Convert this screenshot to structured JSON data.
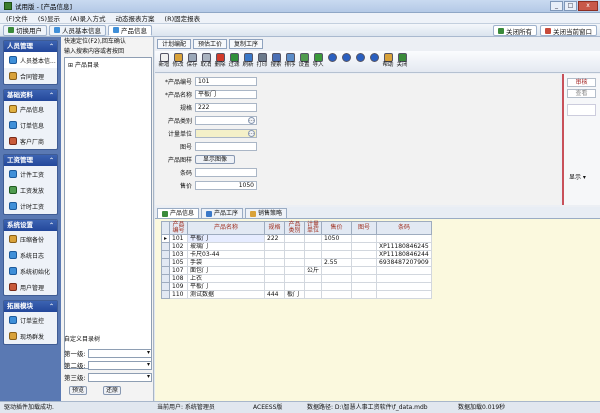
{
  "window": {
    "title": "试用版 - [产品信息]",
    "buttons": [
      "_",
      "□",
      "x"
    ]
  },
  "menu": [
    "(F)文件",
    "(S)显示",
    "(A)录入方式",
    "动态报表方案",
    "(R)固定报表"
  ],
  "navbar": {
    "tabs": [
      {
        "label": "切换用户",
        "active": false
      },
      {
        "label": "人员基本信息",
        "active": false
      },
      {
        "label": "产品信息",
        "active": true
      }
    ],
    "close_all": "关闭所有",
    "close_current": "关闭当前窗口"
  },
  "sidebar": {
    "groups": [
      {
        "title": "人员管理",
        "items": [
          {
            "label": "人员基本信...",
            "selected": true
          },
          {
            "label": "合同管理",
            "selected": false
          }
        ]
      },
      {
        "title": "基础资料",
        "items": [
          {
            "label": "产品信息",
            "selected": false
          },
          {
            "label": "订单信息",
            "selected": false
          },
          {
            "label": "客户厂商",
            "selected": false
          }
        ]
      },
      {
        "title": "工资管理",
        "items": [
          {
            "label": "计件工资",
            "selected": false
          },
          {
            "label": "工资发放",
            "selected": false
          },
          {
            "label": "计时工资",
            "selected": false
          }
        ]
      },
      {
        "title": "系统设置",
        "items": [
          {
            "label": "压缩备份",
            "selected": false
          },
          {
            "label": "系统日志",
            "selected": false
          },
          {
            "label": "系统初始化",
            "selected": false
          },
          {
            "label": "用户管理",
            "selected": false
          }
        ]
      },
      {
        "title": "拓展模块",
        "items": [
          {
            "label": "订单监控",
            "selected": false
          },
          {
            "label": "现场群发",
            "selected": false
          }
        ]
      }
    ]
  },
  "treepane": {
    "hint1": "快速定位(F2),回车确认",
    "hint2": "输入搜索内容或者按回",
    "root": "产品目录",
    "custom_title": "自定义目录树",
    "levels": [
      "第一级:",
      "第二级:",
      "第三级:"
    ],
    "btn_apply": "预览",
    "btn_restore": "还原"
  },
  "subtabs": [
    "计划编配",
    "预估工价",
    "复制工序"
  ],
  "toolbar": [
    {
      "label": "新增",
      "icon": "new-doc-icon",
      "color": "#f0f0f0"
    },
    {
      "label": "修改",
      "icon": "edit-icon",
      "color": "#d9a23a"
    },
    {
      "label": "保存",
      "icon": "save-icon",
      "color": "#9aa7b8"
    },
    {
      "label": "取消",
      "icon": "cancel-icon",
      "color": "#aab3c0"
    },
    {
      "label": "删除",
      "icon": "delete-icon",
      "color": "#d23a2a"
    },
    {
      "label": "过滤",
      "icon": "filter-icon",
      "color": "#2f8f3a"
    },
    {
      "label": "刷新",
      "icon": "refresh-icon",
      "color": "#3a78c8"
    },
    {
      "label": "打印",
      "icon": "print-icon",
      "color": "#6c7a8c"
    },
    {
      "label": "搜索",
      "icon": "search-icon",
      "color": "#4a6fb5"
    },
    {
      "label": "排序",
      "icon": "sort-icon",
      "color": "#5a8cc8"
    },
    {
      "label": "设置",
      "icon": "settings-icon",
      "color": "#4f9b4f"
    },
    {
      "label": "导入",
      "icon": "import-icon",
      "color": "#3b9a3b"
    },
    {
      "label": "",
      "icon": "first-icon",
      "color": "#2a5fc0"
    },
    {
      "label": "",
      "icon": "prev-icon",
      "color": "#2a5fc0"
    },
    {
      "label": "",
      "icon": "next-icon",
      "color": "#2a5fc0"
    },
    {
      "label": "",
      "icon": "last-icon",
      "color": "#2a5fc0"
    },
    {
      "label": "帮助",
      "icon": "help-icon",
      "color": "#d9a23a"
    },
    {
      "label": "关闭",
      "icon": "close-icon",
      "color": "#3a8a3a"
    }
  ],
  "form": {
    "code_label": "*产品编号",
    "code_value": "101",
    "name_label": "*产品名称",
    "name_value": "平板门",
    "spec_label": "规格",
    "spec_value": "222",
    "category_label": "产品类别",
    "category_value": "",
    "unit_label": "计量单位",
    "unit_value": "",
    "drawing_label": "图号",
    "drawing_value": "",
    "image_label": "产品图样",
    "image_button": "显示图像",
    "barcode_label": "条码",
    "barcode_value": "",
    "price_label": "售价",
    "price_value": "1050"
  },
  "rightpanel": {
    "audit": "审核",
    "view": "查看",
    "display": "显示"
  },
  "bottom_tabs": [
    {
      "label": "产品信息",
      "active": true
    },
    {
      "label": "产品工序",
      "active": false
    },
    {
      "label": "销售策略",
      "active": false
    }
  ],
  "grid": {
    "columns": [
      "产品编号",
      "产品名称",
      "规格",
      "产品类别",
      "计量单位",
      "售价",
      "图号",
      "条码"
    ],
    "rows": [
      [
        "101",
        "平板门",
        "222",
        "",
        "",
        "1050",
        "",
        ""
      ],
      [
        "102",
        "玻璃门",
        "",
        "",
        "",
        "",
        "",
        "XP11180846245"
      ],
      [
        "103",
        "卡尺03-44",
        "",
        "",
        "",
        "",
        "",
        "XP11180846244"
      ],
      [
        "105",
        "手袋",
        "",
        "",
        "",
        "2.55",
        "",
        "6938487207909"
      ],
      [
        "107",
        "面包门",
        "",
        "",
        "公斤",
        "",
        "",
        ""
      ],
      [
        "108",
        "上衣",
        "",
        "",
        "",
        "",
        "",
        ""
      ],
      [
        "109",
        "平板门",
        "",
        "",
        "",
        "",
        "",
        ""
      ],
      [
        "110",
        "测试数据",
        "444",
        "板门",
        "",
        "",
        "",
        ""
      ]
    ]
  },
  "status": {
    "loaded": "驱动插件加载成功.",
    "user": "当前用户: 系统管理员",
    "db_type": "ACEESS版",
    "db_path": "数据路径: D:\\智慧人事工资软件\\f_data.mdb",
    "load_time": "数据加载0.019秒"
  }
}
